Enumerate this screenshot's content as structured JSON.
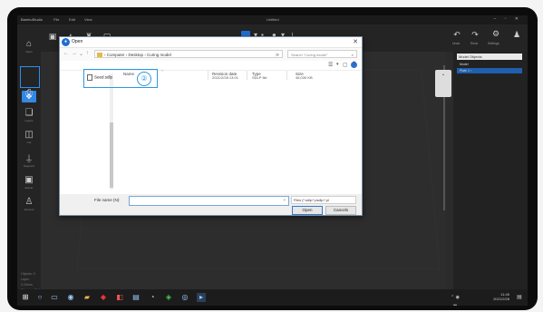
{
  "topbar": {
    "app_title": "BambuStudio",
    "menus": [
      "File",
      "Edit",
      "View"
    ],
    "window_title": "Untitled"
  },
  "toolbar": {
    "right_labels": [
      "Undo",
      "Redo",
      "Preview",
      "Settings"
    ]
  },
  "leftbar": {
    "items": [
      {
        "icon": "folder-open-icon",
        "label": "Open"
      },
      {
        "icon": "rotate-icon",
        "label": "Move"
      },
      {
        "icon": "print-icon",
        "label": "Print"
      },
      {
        "icon": "layers-icon",
        "label": "Layers"
      },
      {
        "icon": "cut-icon",
        "label": "Cut"
      },
      {
        "icon": "support-icon",
        "label": "Supports"
      },
      {
        "icon": "export-icon",
        "label": "Export"
      },
      {
        "icon": "user-icon",
        "label": "Account"
      }
    ],
    "info_lines": [
      "Objects: 0",
      "Layer: 0.20mm",
      "Filament: PLA",
      "Time: --:--"
    ]
  },
  "dialog": {
    "title": "Open",
    "breadcrumbs": "› Computer › Desktop › Curing model",
    "search_placeholder": "Search \"Curing model\"",
    "columns": [
      "Name",
      "Revision date",
      "Type",
      "Size"
    ],
    "file": {
      "name": "Seed.sdlp",
      "date": "2021/2/28 13:01",
      "type": "SDLP file",
      "size": "46,030 KB"
    },
    "step_marker": "②",
    "file_name_label": "File name (N):",
    "file_name_value": "",
    "type_filter": "Files (*.sdlp;*.psdlp;*.pl",
    "open_button": "Open",
    "cancel_button": "Cancels"
  },
  "rightpanel": {
    "header": "Model Objects",
    "rows": [
      "Model",
      "Plate 1 ›"
    ]
  },
  "taskbar": {
    "time": "11:45",
    "date": "2021/2/28"
  },
  "colors": {
    "accent": "#1f6fd0",
    "highlight": "#2b98e0",
    "background": "#2b2b2b"
  }
}
